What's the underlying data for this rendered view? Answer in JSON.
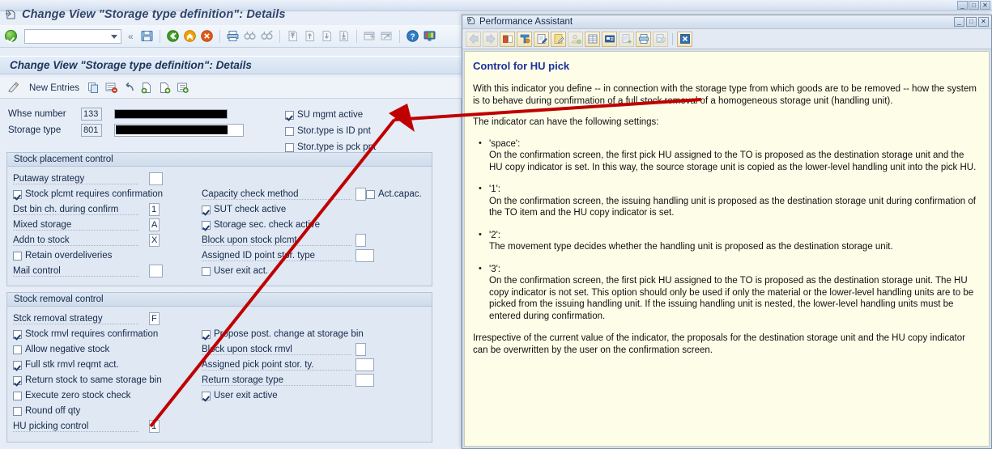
{
  "window": {
    "title": "Change View \"Storage type definition\": Details",
    "minimize": "_",
    "maximize": "□",
    "close": "✕"
  },
  "toolbar": {
    "command_value": "",
    "command_placeholder": "",
    "back_chevrons": "«",
    "icons": [
      {
        "name": "enter-icon",
        "label": "Enter"
      },
      {
        "name": "save-icon",
        "label": "Save"
      },
      {
        "name": "back-icon",
        "label": "Back"
      },
      {
        "name": "exit-icon",
        "label": "Exit"
      },
      {
        "name": "cancel-icon",
        "label": "Cancel"
      },
      {
        "name": "print-icon",
        "label": "Print"
      },
      {
        "name": "find-icon",
        "label": "Find"
      },
      {
        "name": "find-next-icon",
        "label": "Find Next"
      },
      {
        "name": "first-page-icon",
        "label": "First Page"
      },
      {
        "name": "previous-page-icon",
        "label": "Previous Page"
      },
      {
        "name": "next-page-icon",
        "label": "Next Page"
      },
      {
        "name": "last-page-icon",
        "label": "Last Page"
      },
      {
        "name": "create-session-icon",
        "label": "Create Session"
      },
      {
        "name": "create-shortcut-icon",
        "label": "Create Shortcut"
      },
      {
        "name": "help-icon",
        "label": "Help"
      },
      {
        "name": "customize-layout-icon",
        "label": "Customize Local Layout"
      }
    ]
  },
  "page": {
    "heading": "Change View \"Storage type definition\": Details",
    "actions": {
      "display_change_label": "",
      "new_entries_label": "New Entries",
      "icons": [
        {
          "name": "display-change-icon"
        },
        {
          "name": "copy-icon"
        },
        {
          "name": "delete-row-icon"
        },
        {
          "name": "undo-icon"
        },
        {
          "name": "previous-entry-icon"
        },
        {
          "name": "next-entry-icon"
        },
        {
          "name": "details-icon"
        }
      ]
    }
  },
  "header_fields": {
    "whse_number": {
      "label": "Whse number",
      "key": "133",
      "description": ""
    },
    "storage_type": {
      "label": "Storage type",
      "key": "801",
      "description": ""
    },
    "checkboxes": [
      {
        "label": "SU mgmt active",
        "checked": true
      },
      {
        "label": "Stor.type is ID pnt",
        "checked": false
      },
      {
        "label": "Stor.type is pck pnt",
        "checked": false
      }
    ]
  },
  "stock_placement": {
    "title": "Stock placement control",
    "left": [
      {
        "type": "field",
        "label": "Putaway strategy",
        "value": "",
        "width": "wide"
      },
      {
        "type": "check",
        "label": "Stock plcmt requires confirmation",
        "checked": true
      },
      {
        "type": "field",
        "label": "Dst bin ch. during confirm",
        "value": "1",
        "width": "narrow"
      },
      {
        "type": "field",
        "label": "Mixed storage",
        "value": "A",
        "width": "narrow"
      },
      {
        "type": "field",
        "label": "Addn to stock",
        "value": "X",
        "width": "narrow"
      },
      {
        "type": "check",
        "label": "Retain overdeliveries",
        "checked": false
      },
      {
        "type": "field",
        "label": "Mail control",
        "value": "",
        "width": "wide"
      }
    ],
    "right": [
      {
        "type": "field",
        "label": "Capacity check method",
        "value": "",
        "width": "narrow",
        "extra_check": {
          "label": "Act.capac.",
          "checked": false
        }
      },
      {
        "type": "check",
        "label": "SUT check active",
        "checked": true
      },
      {
        "type": "check",
        "label": "Storage sec. check active",
        "checked": true
      },
      {
        "type": "field",
        "label": "Block upon stock plcmt",
        "value": "",
        "width": "narrow"
      },
      {
        "type": "field",
        "label": "Assigned ID point stor. type",
        "value": "",
        "width": "wide"
      },
      {
        "type": "check",
        "label": "User exit act.",
        "checked": false
      }
    ]
  },
  "stock_removal": {
    "title": "Stock removal control",
    "left": [
      {
        "type": "field",
        "label": "Stck removal strategy",
        "value": "F",
        "width": "narrow"
      },
      {
        "type": "check",
        "label": "Stock rmvl requires confirmation",
        "checked": true
      },
      {
        "type": "check",
        "label": "Allow negative stock",
        "checked": false
      },
      {
        "type": "check",
        "label": "Full stk rmvl reqmt act.",
        "checked": true
      },
      {
        "type": "check",
        "label": "Return stock to same storage bin",
        "checked": true
      },
      {
        "type": "check",
        "label": "Execute zero stock check",
        "checked": false
      },
      {
        "type": "check",
        "label": "Round off qty",
        "checked": false
      },
      {
        "type": "field",
        "label": "HU picking control",
        "value": "1",
        "width": "narrow"
      }
    ],
    "right": [
      {
        "type": "check",
        "label": "Propose post. change at storage bin",
        "checked": true
      },
      {
        "type": "field",
        "label": "Block upon stock rmvl",
        "value": "",
        "width": "narrow"
      },
      {
        "type": "field",
        "label": "Assigned pick point stor. ty.",
        "value": "",
        "width": "wide"
      },
      {
        "type": "field",
        "label": "Return storage type",
        "value": "",
        "width": "wide"
      },
      {
        "type": "check",
        "label": "User exit active",
        "checked": true
      }
    ]
  },
  "performance_assistant": {
    "title": "Performance Assistant",
    "window_buttons": {
      "minimize": "_",
      "maximize": "□",
      "close": "✕"
    },
    "toolbar_icons": [
      {
        "name": "back-icon"
      },
      {
        "name": "forward-icon"
      },
      {
        "name": "glossary-icon"
      },
      {
        "name": "technical-information-icon"
      },
      {
        "name": "note-create-icon"
      },
      {
        "name": "note-edit-icon"
      },
      {
        "name": "personal-note-icon"
      },
      {
        "name": "application-help-icon"
      },
      {
        "name": "sap-library-icon"
      },
      {
        "name": "export-icon"
      },
      {
        "name": "print-icon"
      },
      {
        "name": "copy-text-icon"
      },
      {
        "name": "close-help-icon"
      }
    ],
    "heading": "Control for HU pick",
    "paragraphs": [
      "With this indicator you define -- in connection with the storage type from which goods are to be removed -- how the system is to behave during confirmation of a full stock removal of a homogeneous storage unit (handling unit).",
      "The indicator can have the following settings:"
    ],
    "bullets": [
      {
        "key": "'space':",
        "text": "On the confirmation screen, the first pick HU assigned to the TO is proposed as the destination storage unit and the HU copy indicator is set. In this way, the source storage unit is copied as the lower-level handling unit into the pick HU."
      },
      {
        "key": "'1':",
        "text": "On the confirmation screen, the issuing handling unit is proposed as the destination storage unit during confirmation of the TO item and the HU copy indicator is set."
      },
      {
        "key": "'2':",
        "text": "The movement type decides whether the handling unit is proposed as the destination storage unit."
      },
      {
        "key": "'3':",
        "text": "On the confirmation screen, the first pick HU assigned to the TO is proposed as the destination storage unit. The HU copy indicator is not set. This option should only be used if only the material or the lower-level handling units are to be picked from the issuing handling unit. If the issuing handling unit is nested, the lower-level handling units must be entered during confirmation."
      }
    ],
    "closing_paragraph": "Irrespective of the current value of the indicator, the proposals for the destination storage unit and the HU copy indicator can be overwritten by the user on the confirmation screen."
  },
  "annotation": {
    "color": "#c00000",
    "description": "red arrow from HU picking control field to help text"
  }
}
